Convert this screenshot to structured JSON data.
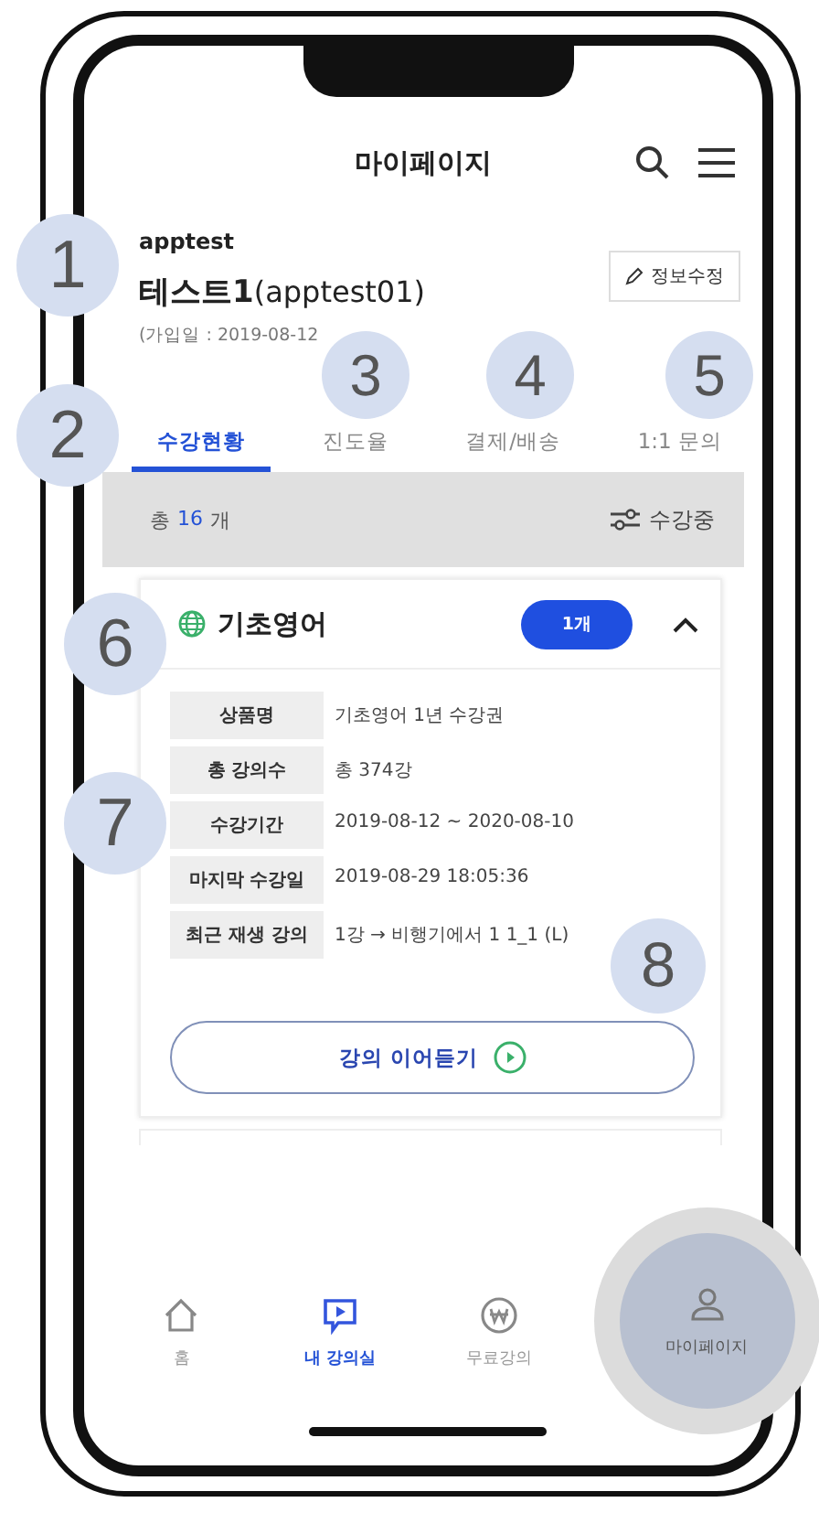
{
  "header": {
    "title": "마이페이지"
  },
  "profile": {
    "id": "apptest",
    "name": "테스트1",
    "account": "(apptest01)",
    "joined": "(가입일 : 2019-08-12",
    "edit_button": "정보수정"
  },
  "tabs": [
    {
      "label": "수강현황",
      "selected": true
    },
    {
      "label": "진도율",
      "selected": false
    },
    {
      "label": "결제/배송",
      "selected": false
    },
    {
      "label": "1:1 문의",
      "selected": false
    }
  ],
  "summary": {
    "prefix": "총",
    "count": "16",
    "unit": "개",
    "filter": "수강중"
  },
  "course": {
    "title": "기초영어",
    "badge": "1개",
    "expanded": true,
    "details": [
      {
        "label": "상품명",
        "value": "기초영어 1년 수강권"
      },
      {
        "label": "총 강의수",
        "value": "총 374강"
      },
      {
        "label": "수강기간",
        "value": "2019-08-12 ~ 2020-08-10"
      },
      {
        "label": "마지막 수강일",
        "value": "2019-08-29 18:05:36"
      },
      {
        "label": "최근 재생 강의",
        "value": "1강 → 비행기에서 1 1_1 (L)"
      }
    ],
    "continue_button": "강의 이어듣기"
  },
  "bottom_nav": [
    {
      "label": "홈",
      "selected": false,
      "highlighted": false
    },
    {
      "label": "내 강의실",
      "selected": true,
      "highlighted": false
    },
    {
      "label": "무료강의",
      "selected": false,
      "highlighted": false
    },
    {
      "label": "마이페이지",
      "selected": false,
      "highlighted": true
    }
  ],
  "annotations": [
    "1",
    "2",
    "3",
    "4",
    "5",
    "6",
    "7",
    "8"
  ]
}
